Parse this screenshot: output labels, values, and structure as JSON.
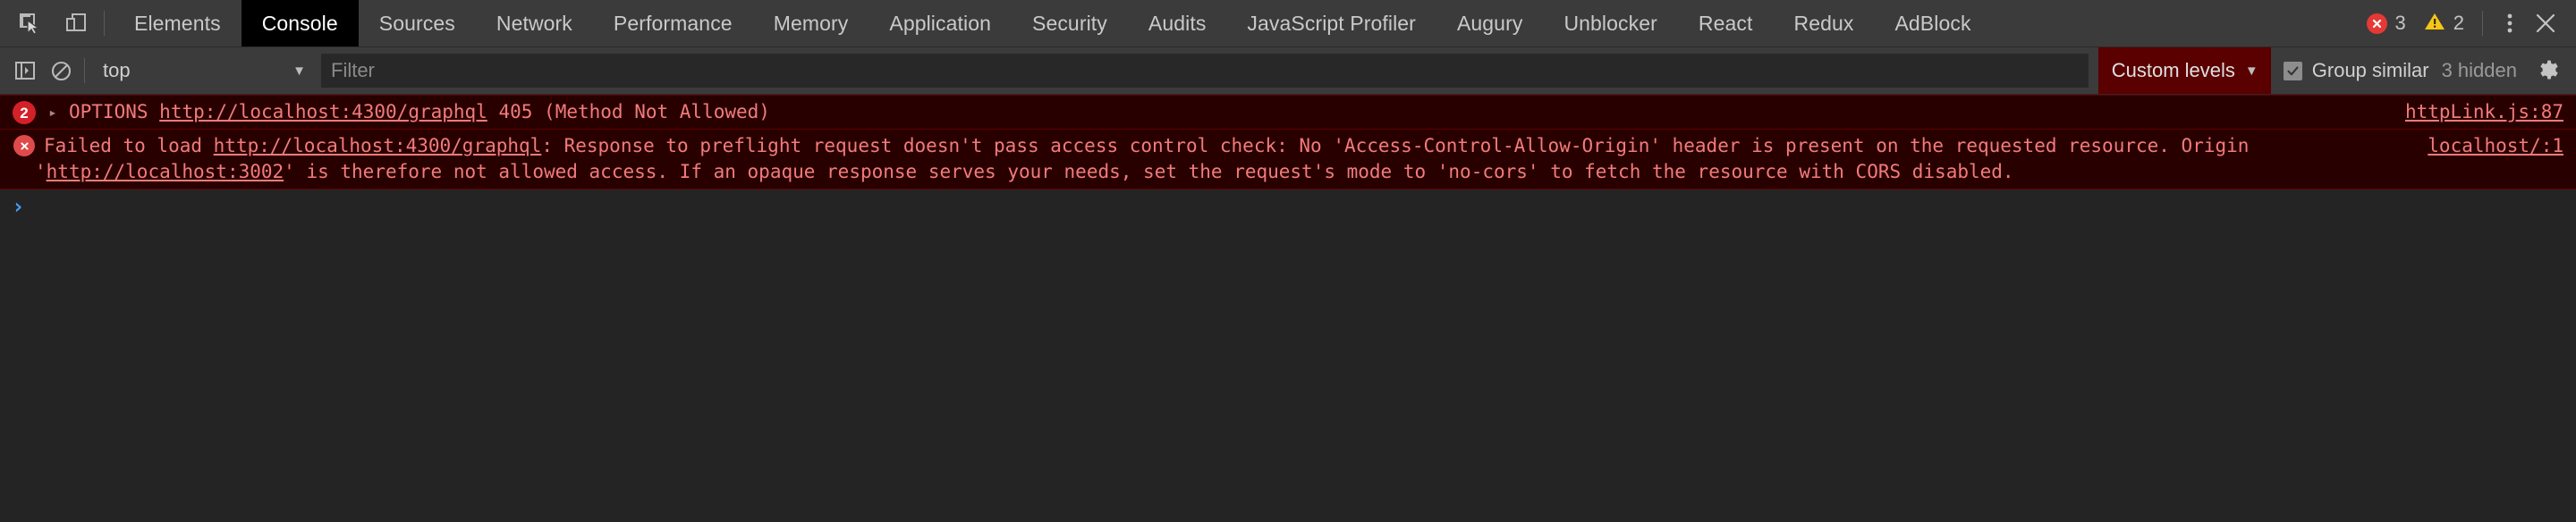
{
  "devtools": {
    "tabs": [
      {
        "label": "Elements",
        "active": false
      },
      {
        "label": "Console",
        "active": true
      },
      {
        "label": "Sources",
        "active": false
      },
      {
        "label": "Network",
        "active": false
      },
      {
        "label": "Performance",
        "active": false
      },
      {
        "label": "Memory",
        "active": false
      },
      {
        "label": "Application",
        "active": false
      },
      {
        "label": "Security",
        "active": false
      },
      {
        "label": "Audits",
        "active": false
      },
      {
        "label": "JavaScript Profiler",
        "active": false
      },
      {
        "label": "Augury",
        "active": false
      },
      {
        "label": "Unblocker",
        "active": false
      },
      {
        "label": "React",
        "active": false
      },
      {
        "label": "Redux",
        "active": false
      },
      {
        "label": "AdBlock",
        "active": false
      }
    ],
    "icons": {
      "inspect": "inspect-element-icon",
      "device": "device-toolbar-icon",
      "more": "more-options-icon",
      "close": "close-devtools-icon"
    },
    "status": {
      "error_count": "3",
      "warning_count": "2"
    }
  },
  "toolbar": {
    "clear_console_icon": "clear-console-icon",
    "sidebar_icon": "console-sidebar-icon",
    "context": {
      "value": "top",
      "caret": "▼"
    },
    "filter": {
      "value": "",
      "placeholder": "Filter"
    },
    "levels": {
      "label": "Custom levels",
      "caret": "▼",
      "accent": "#5a0000"
    },
    "group_similar": {
      "label": "Group similar",
      "checked": true
    },
    "hidden_label": "3 hidden",
    "settings_icon": "gear-icon"
  },
  "messages": [
    {
      "kind": "network-error",
      "repeat_count": "2",
      "expandable": true,
      "disclosure": "▸",
      "method": "OPTIONS",
      "url": "http://localhost:4300/graphql",
      "status": "405 (Method Not Allowed)",
      "source": "httpLink.js:87"
    },
    {
      "kind": "error",
      "prefix": "Failed to load ",
      "url": "http://localhost:4300/graphql",
      "mid": ": Response to preflight request doesn't pass access control check: No 'Access-Control-Allow-Origin' header is present on the requested resource. Origin '",
      "origin_url": "http://localhost:3002",
      "suffix": "' is therefore not allowed access. If an opaque response serves your needs, set the request's mode to 'no-cors' to fetch the resource with CORS disabled.",
      "source": "localhost/:1"
    }
  ],
  "prompt": {
    "caret": "›",
    "value": ""
  },
  "colors": {
    "background": "#242424",
    "chrome": "#3b3b3b",
    "error_bg": "#290000",
    "error_text": "#f27b7b",
    "error_border": "#5c0000",
    "active_tab_bg": "#000000",
    "prompt": "#4a9bf5"
  }
}
